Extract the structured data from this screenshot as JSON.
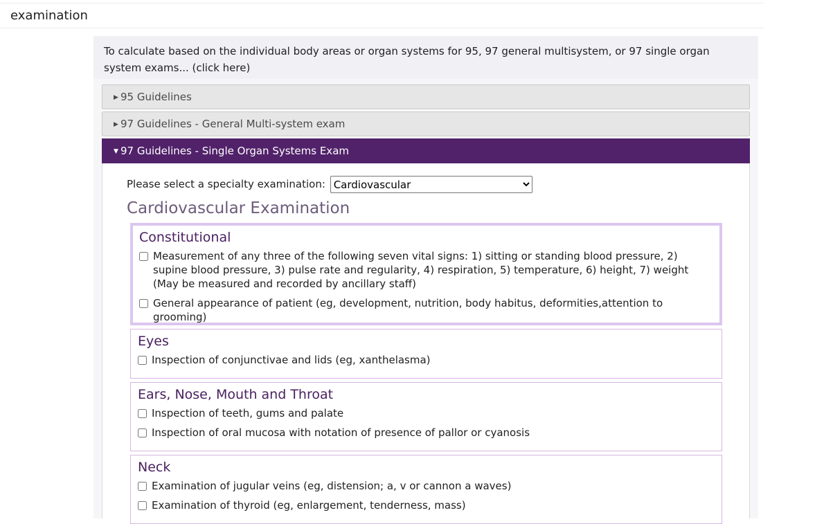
{
  "header": {
    "title": "examination"
  },
  "notice": {
    "text": "To calculate based on the individual body areas or organ systems for 95, 97 general multisystem, or 97 single organ system exams... (click here)"
  },
  "accordion": {
    "items": [
      {
        "label": "95 Guidelines",
        "open": false
      },
      {
        "label": "97 Guidelines - General Multi-system exam",
        "open": false
      },
      {
        "label": "97 Guidelines - Single Organ Systems Exam",
        "open": true
      }
    ]
  },
  "specialty": {
    "label": "Please select a specialty examination:",
    "selected": "Cardiovascular"
  },
  "exam_title": "Cardiovascular Examination",
  "sections": [
    {
      "title": "Constitutional",
      "items": [
        "Measurement of any three of the following seven vital signs: 1) sitting or standing blood pressure, 2) supine blood pressure, 3) pulse rate and regularity, 4) respiration, 5) temperature, 6) height, 7) weight (May be measured and recorded by ancillary staff)",
        "General appearance of patient (eg, development, nutrition, body habitus, deformities,attention to grooming)"
      ]
    },
    {
      "title": "Eyes",
      "items": [
        "Inspection of conjunctivae and lids (eg, xanthelasma)"
      ]
    },
    {
      "title": "Ears, Nose, Mouth and Throat",
      "items": [
        "Inspection of teeth, gums and palate",
        "Inspection of oral mucosa with notation of presence of pallor or cyanosis"
      ]
    },
    {
      "title": "Neck",
      "items": [
        "Examination of jugular veins (eg, distension; a, v or cannon a waves)",
        "Examination of thyroid (eg, enlargement, tenderness, mass)"
      ]
    }
  ],
  "colors": {
    "accordion_open": "#51226a",
    "section_title": "#4a2060",
    "exam_title": "#6c5b7b",
    "highlight_border": "#dcc6f0"
  }
}
